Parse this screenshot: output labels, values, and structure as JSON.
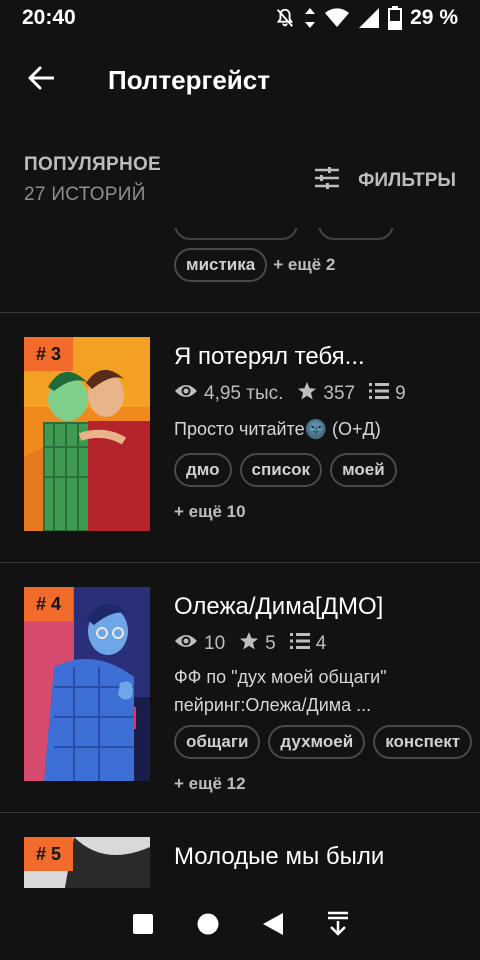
{
  "status": {
    "time": "20:40",
    "battery": "29 %"
  },
  "header": {
    "title": "Полтергейст"
  },
  "sort": {
    "label": "ПОПУЛЯРНОЕ",
    "count": "27 ИСТОРИЙ",
    "filter_label": "ФИЛЬТРЫ"
  },
  "prev_item": {
    "tag": "мистика",
    "more": "+ ещё 2"
  },
  "stories": [
    {
      "rank": "# 3",
      "title": "Я потерял тебя...",
      "views": "4,95 тыс.",
      "votes": "357",
      "parts": "9",
      "description": "Просто читайте🌚 (О+Д)",
      "tags": [
        "дмо",
        "список",
        "моей"
      ],
      "more": "+ ещё 10"
    },
    {
      "rank": "# 4",
      "title": "Олежа/Дима[ДМО]",
      "views": "10",
      "votes": "5",
      "parts": "4",
      "description": "ФФ по \"дух моей общаги\"",
      "description_2": "пейринг:Олежа/Дима ...",
      "tags": [
        "общаги",
        "духмоей",
        "конспект"
      ],
      "more": "+ ещё 12"
    },
    {
      "rank": "# 5",
      "title": "Молодые мы были"
    }
  ],
  "colors": {
    "accent": "#f26b2a",
    "background": "#121212"
  }
}
